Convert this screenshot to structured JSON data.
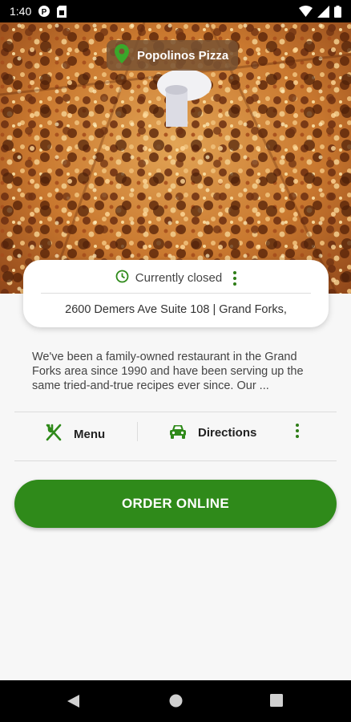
{
  "status_bar": {
    "time": "1:40",
    "icons": [
      "p-badge-icon",
      "sim-card-icon",
      "wifi-icon",
      "signal-icon",
      "battery-icon"
    ]
  },
  "hero": {
    "image": "pizza-photo",
    "brand_name": "Popolinos Pizza",
    "brand_icon": "location-pin-icon"
  },
  "info_card": {
    "status_text": "Currently closed",
    "status_icon": "clock-icon",
    "address": "2600 Demers Ave Suite 108 | Grand Forks,"
  },
  "description": "We've been a family-owned restaurant in the Grand Forks area since 1990 and have been serving up the same tried-and-true recipes ever since. Our ...",
  "actions": {
    "menu_label": "Menu",
    "menu_icon": "fork-knife-icon",
    "directions_label": "Directions",
    "directions_icon": "car-icon",
    "more_icon": "more-vertical-icon"
  },
  "order_button": {
    "label": "ORDER ONLINE"
  },
  "nav_bar": {
    "buttons": [
      "back-icon",
      "home-icon",
      "recents-icon"
    ]
  },
  "colors": {
    "accent_green": "#2f8a1a",
    "chip_bg": "#785232",
    "status_bar": "#000000"
  }
}
